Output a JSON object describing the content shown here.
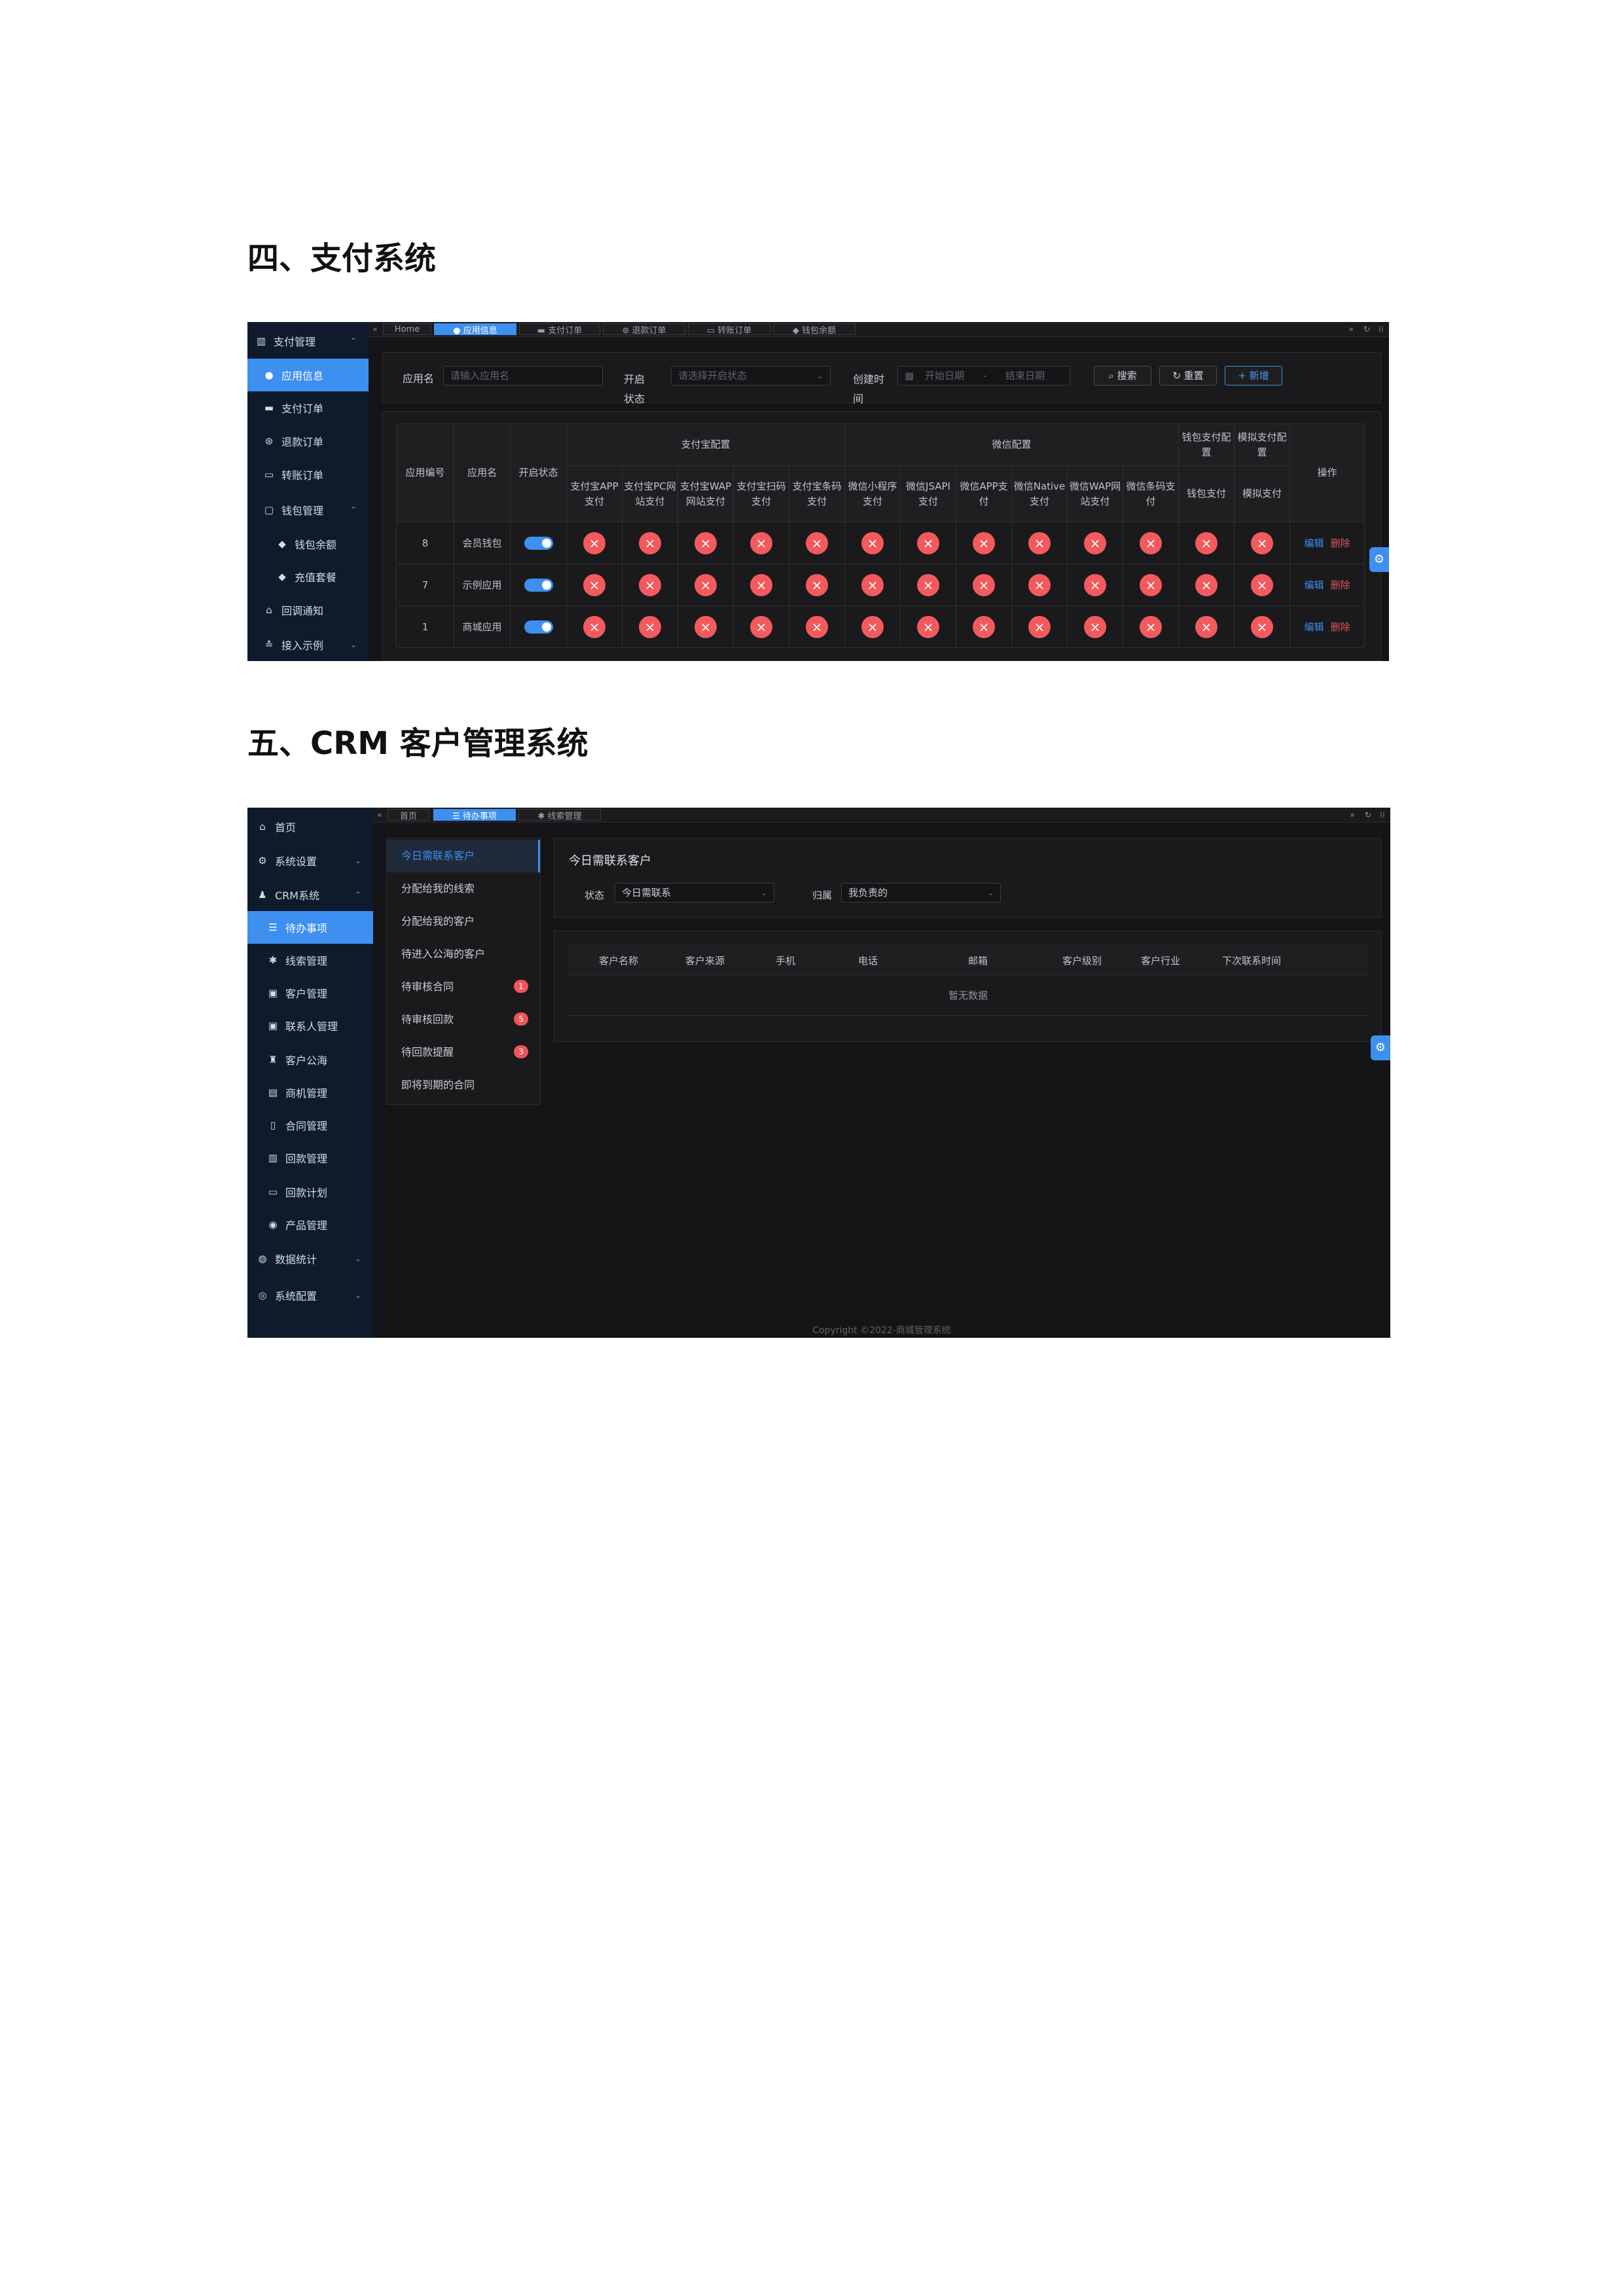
{
  "section4": {
    "heading": "四、支付系统",
    "sidebar": [
      {
        "icon": "▥",
        "label": "支付管理",
        "chevron": "⌃"
      },
      {
        "icon": "●",
        "label": "应用信息"
      },
      {
        "icon": "▬",
        "label": "支付订单"
      },
      {
        "icon": "⊛",
        "label": "退款订单"
      },
      {
        "icon": "▭",
        "label": "转账订单"
      },
      {
        "icon": "▢",
        "label": "钱包管理",
        "chevron": "⌃"
      },
      {
        "icon": "◆",
        "label": "钱包余额"
      },
      {
        "icon": "◆",
        "label": "充值套餐"
      },
      {
        "icon": "⌂",
        "label": "回调通知"
      },
      {
        "icon": "≛",
        "label": "接入示例",
        "chevron": "⌄"
      }
    ],
    "tabs": [
      {
        "label": "Home"
      },
      {
        "label": "● 应用信息"
      },
      {
        "label": "▬ 支付订单"
      },
      {
        "label": "⊛ 退款订单"
      },
      {
        "label": "▭ 转账订单"
      },
      {
        "label": "◆ 钱包余额"
      }
    ],
    "tab_tools": [
      "»",
      "↻",
      "⁞⁞"
    ],
    "filters": {
      "app_name_label": "应用名",
      "app_name_placeholder": "请输入应用名",
      "status_label": "开启状态",
      "status_placeholder": "请选择开启状态",
      "created_label": "创建时间",
      "date_start": "开始日期",
      "date_sep": "-",
      "date_end": "结束日期",
      "search": "搜索",
      "reset": "重置",
      "add": "新增"
    },
    "table": {
      "col_id": "应用编号",
      "col_name": "应用名",
      "col_status": "开启状态",
      "group_alipay": "支付宝配置",
      "group_wechat": "微信配置",
      "col_wallet": "钱包支付配置",
      "col_mock": "模拟支付配置",
      "col_op": "操作",
      "alipay_cols": [
        "支付宝APP支付",
        "支付宝PC网站支付",
        "支付宝WAP网站支付",
        "支付宝扫码支付",
        "支付宝条码支付"
      ],
      "wechat_cols": [
        "微信小程序支付",
        "微信JSAPI支付",
        "微信APP支付",
        "微信Native支付",
        "微信WAP网站支付",
        "微信条码支付"
      ],
      "wallet_sub": "钱包支付",
      "mock_sub": "模拟支付",
      "rows": [
        {
          "id": "8",
          "name": "会员钱包",
          "enabled": true
        },
        {
          "id": "7",
          "name": "示例应用",
          "enabled": true
        },
        {
          "id": "1",
          "name": "商城应用",
          "enabled": true
        }
      ],
      "edit": "编辑",
      "delete": "删除"
    }
  },
  "section5": {
    "heading": "五、CRM 客户管理系统",
    "sidebar": [
      {
        "icon": "⌂",
        "label": "首页"
      },
      {
        "icon": "⚙",
        "label": "系统设置",
        "chevron": "⌄"
      },
      {
        "icon": "♟",
        "label": "CRM系统",
        "chevron": "⌃"
      },
      {
        "icon": "☰",
        "label": "待办事项"
      },
      {
        "icon": "✱",
        "label": "线索管理"
      },
      {
        "icon": "▣",
        "label": "客户管理"
      },
      {
        "icon": "▣",
        "label": "联系人管理"
      },
      {
        "icon": "♜",
        "label": "客户公海"
      },
      {
        "icon": "▤",
        "label": "商机管理"
      },
      {
        "icon": "▯",
        "label": "合同管理"
      },
      {
        "icon": "▥",
        "label": "回款管理"
      },
      {
        "icon": "▭",
        "label": "回款计划"
      },
      {
        "icon": "◉",
        "label": "产品管理"
      },
      {
        "icon": "◍",
        "label": "数据统计",
        "chevron": "⌄"
      },
      {
        "icon": "◎",
        "label": "系统配置",
        "chevron": "⌄"
      }
    ],
    "tabs": [
      {
        "label": "首页"
      },
      {
        "label": "☰ 待办事项"
      },
      {
        "label": "✱ 线索管理"
      }
    ],
    "tab_tools": [
      "»",
      "↻",
      "⁞⁞"
    ],
    "todo": [
      {
        "label": "今日需联系客户"
      },
      {
        "label": "分配给我的线索"
      },
      {
        "label": "分配给我的客户"
      },
      {
        "label": "待进入公海的客户"
      },
      {
        "label": "待审核合同",
        "badge": "1"
      },
      {
        "label": "待审核回款",
        "badge": "5"
      },
      {
        "label": "待回款提醒",
        "badge": "3"
      },
      {
        "label": "即将到期的合同"
      }
    ],
    "panel_title": "今日需联系客户",
    "filter": {
      "status_label": "状态",
      "status_value": "今日需联系",
      "owner_label": "归属",
      "owner_value": "我负责的"
    },
    "columns": [
      "客户名称",
      "客户来源",
      "手机",
      "电话",
      "邮箱",
      "客户级别",
      "客户行业",
      "下次联系时间"
    ],
    "empty_text": "暂无数据",
    "footer": "Copyright ©2022-商城管理系统"
  },
  "colors": {
    "accent": "#3d8ff0",
    "danger": "#f25a5e",
    "sidebar_bg": "#0f1b2d",
    "content_bg": "#151517"
  }
}
